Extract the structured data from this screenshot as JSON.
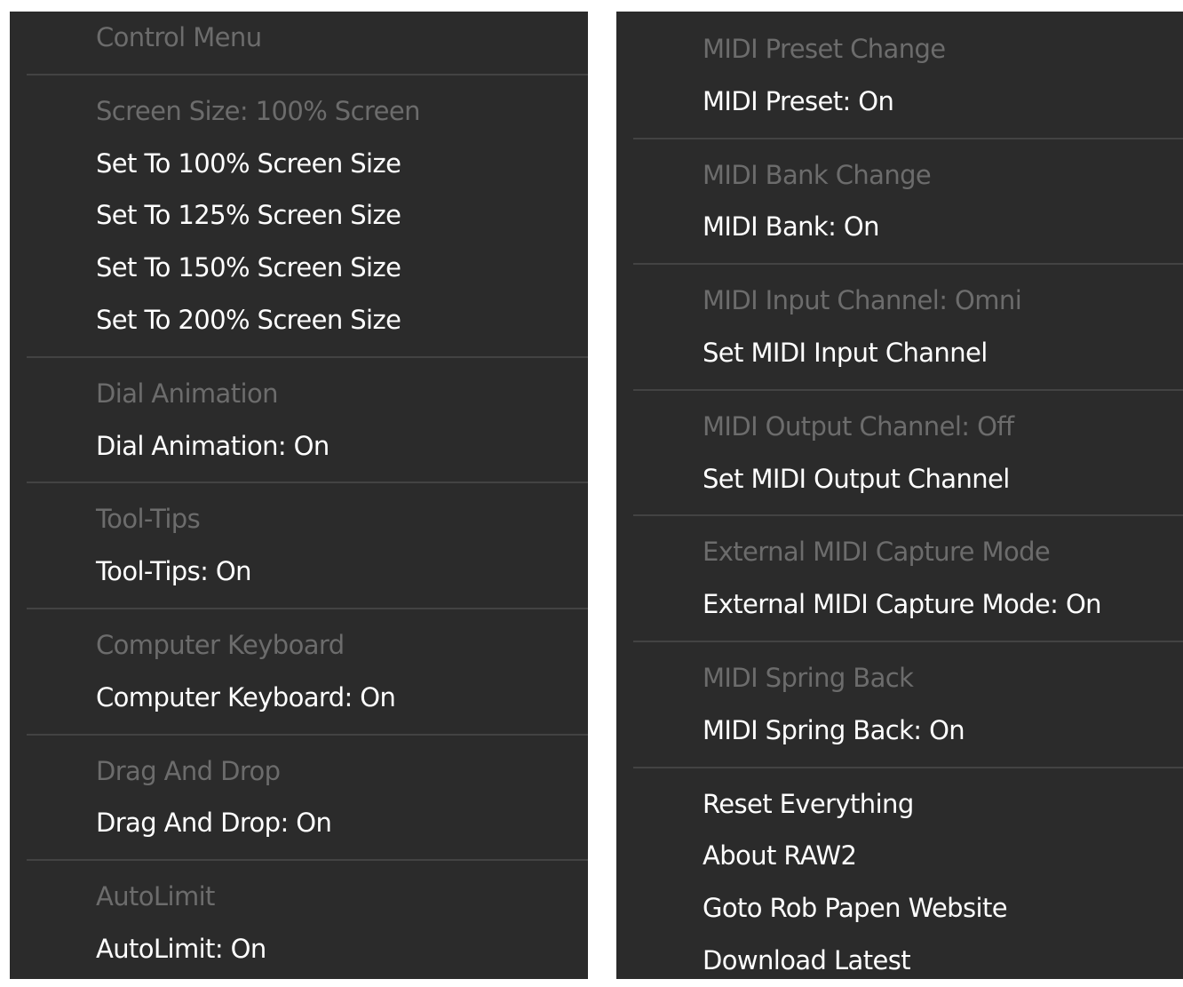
{
  "left_menu": [
    {
      "type": "header",
      "name": "control-menu-header",
      "label": "Control Menu"
    },
    {
      "type": "separator"
    },
    {
      "type": "header",
      "name": "screen-size-header",
      "label": "Screen Size: 100% Screen"
    },
    {
      "type": "item",
      "name": "set-100-screen-size",
      "label": "Set To 100% Screen Size"
    },
    {
      "type": "item",
      "name": "set-125-screen-size",
      "label": "Set To 125% Screen Size"
    },
    {
      "type": "item",
      "name": "set-150-screen-size",
      "label": "Set To 150% Screen Size"
    },
    {
      "type": "item",
      "name": "set-200-screen-size",
      "label": "Set To 200% Screen Size"
    },
    {
      "type": "separator"
    },
    {
      "type": "header",
      "name": "dial-animation-header",
      "label": "Dial Animation"
    },
    {
      "type": "item",
      "name": "dial-animation-toggle",
      "label": "Dial Animation: On"
    },
    {
      "type": "separator"
    },
    {
      "type": "header",
      "name": "tool-tips-header",
      "label": "Tool-Tips"
    },
    {
      "type": "item",
      "name": "tool-tips-toggle",
      "label": "Tool-Tips: On"
    },
    {
      "type": "separator"
    },
    {
      "type": "header",
      "name": "computer-keyboard-header",
      "label": "Computer Keyboard"
    },
    {
      "type": "item",
      "name": "computer-keyboard-toggle",
      "label": "Computer Keyboard: On"
    },
    {
      "type": "separator"
    },
    {
      "type": "header",
      "name": "drag-and-drop-header",
      "label": "Drag And Drop"
    },
    {
      "type": "item",
      "name": "drag-and-drop-toggle",
      "label": "Drag And Drop: On"
    },
    {
      "type": "separator"
    },
    {
      "type": "header",
      "name": "autolimit-header",
      "label": "AutoLimit"
    },
    {
      "type": "item",
      "name": "autolimit-toggle",
      "label": "AutoLimit: On"
    }
  ],
  "right_menu": [
    {
      "type": "header",
      "name": "midi-preset-change-header",
      "label": "MIDI Preset Change"
    },
    {
      "type": "item",
      "name": "midi-preset-toggle",
      "label": "MIDI Preset: On"
    },
    {
      "type": "separator"
    },
    {
      "type": "header",
      "name": "midi-bank-change-header",
      "label": "MIDI Bank Change"
    },
    {
      "type": "item",
      "name": "midi-bank-toggle",
      "label": "MIDI Bank: On"
    },
    {
      "type": "separator"
    },
    {
      "type": "header",
      "name": "midi-input-channel-header",
      "label": "MIDI Input Channel: Omni"
    },
    {
      "type": "item",
      "name": "set-midi-input-channel",
      "label": "Set MIDI Input Channel"
    },
    {
      "type": "separator"
    },
    {
      "type": "header",
      "name": "midi-output-channel-header",
      "label": "MIDI Output Channel: Off"
    },
    {
      "type": "item",
      "name": "set-midi-output-channel",
      "label": "Set MIDI Output Channel"
    },
    {
      "type": "separator"
    },
    {
      "type": "header",
      "name": "external-midi-capture-header",
      "label": "External MIDI Capture Mode"
    },
    {
      "type": "item",
      "name": "external-midi-capture-toggle",
      "label": "External MIDI Capture Mode: On"
    },
    {
      "type": "separator"
    },
    {
      "type": "header",
      "name": "midi-spring-back-header",
      "label": "MIDI Spring Back"
    },
    {
      "type": "item",
      "name": "midi-spring-back-toggle",
      "label": "MIDI Spring Back: On"
    },
    {
      "type": "separator"
    },
    {
      "type": "item",
      "name": "reset-everything",
      "label": "Reset Everything"
    },
    {
      "type": "item",
      "name": "about-raw2",
      "label": "About RAW2"
    },
    {
      "type": "item",
      "name": "goto-rob-papen-website",
      "label": "Goto Rob Papen Website"
    },
    {
      "type": "item",
      "name": "download-latest",
      "label": "Download Latest"
    }
  ]
}
